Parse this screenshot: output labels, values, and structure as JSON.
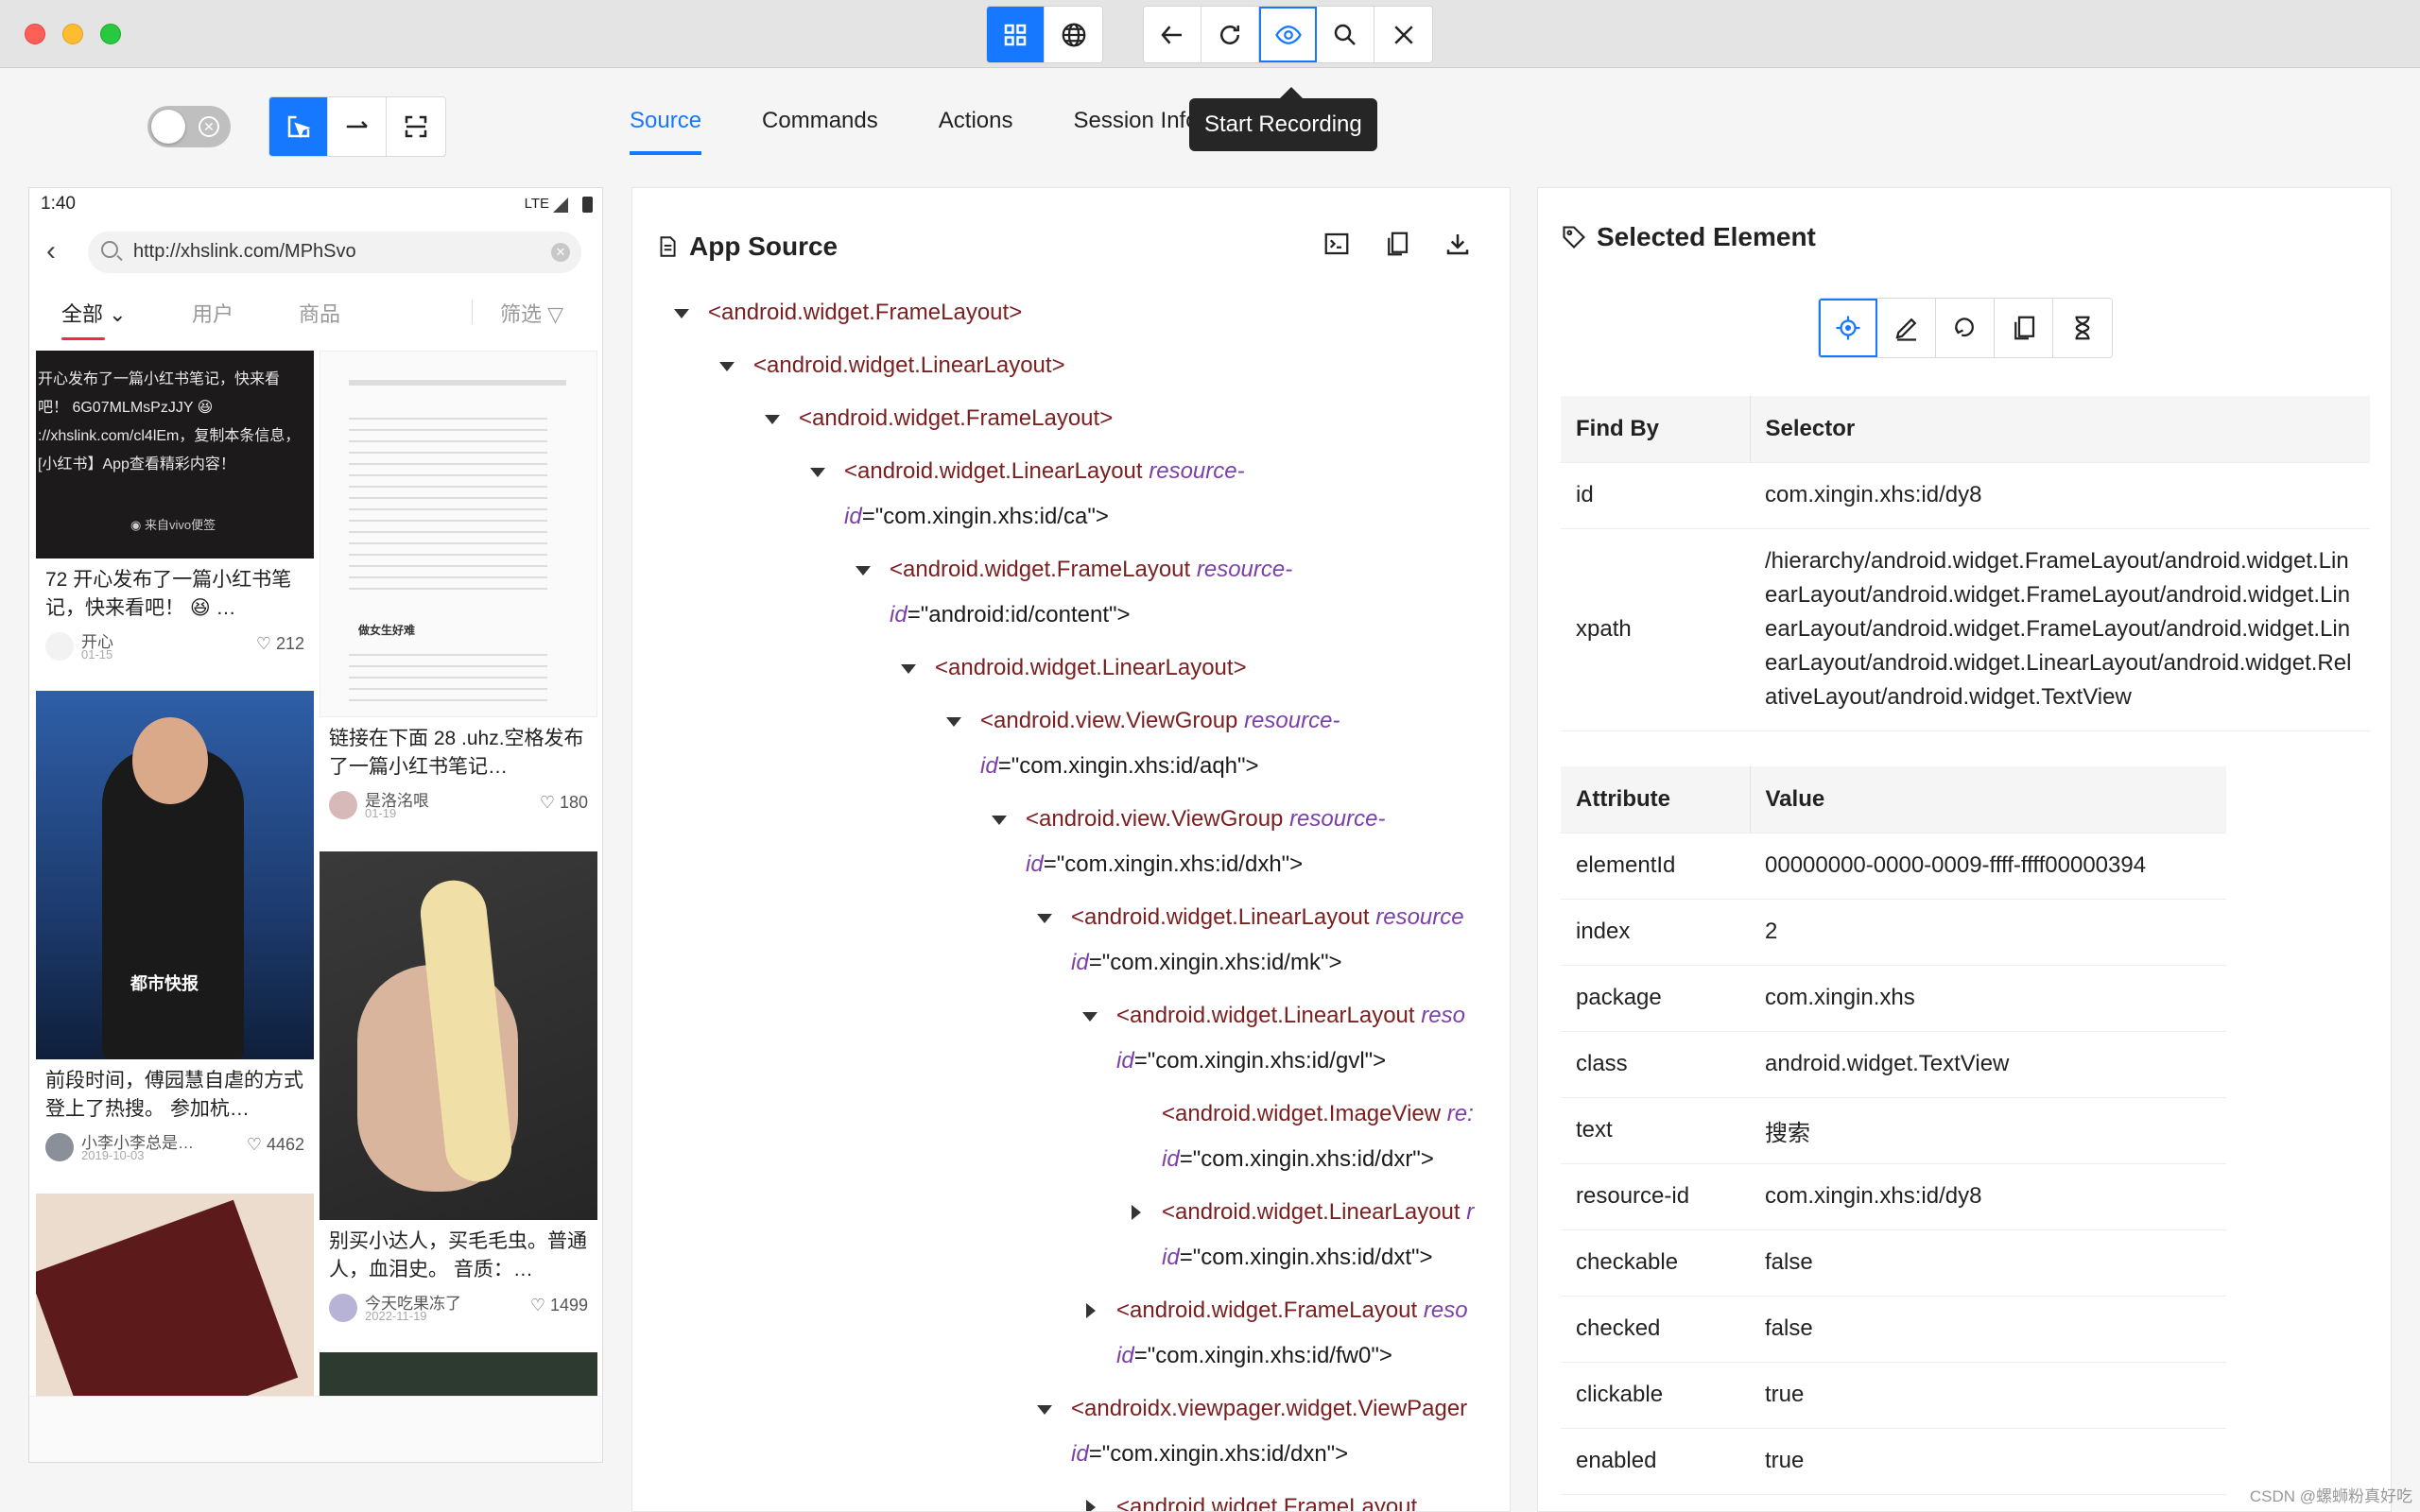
{
  "toolbar": {
    "buttons": [
      "grid-view",
      "web-globe",
      "back",
      "refresh",
      "start-recording",
      "search",
      "quit-session"
    ]
  },
  "tabs": [
    "Source",
    "Commands",
    "Actions",
    "Session Information"
  ],
  "tooltip": "Start Recording",
  "phone": {
    "time": "1:40",
    "network": "LTE",
    "search_text": "http://xhslink.com/MPhSvo",
    "filters": [
      "全部",
      "用户",
      "商品",
      "筛选"
    ],
    "cards": [
      {
        "title": "72 开心发布了一篇小红书笔记，快来看吧！ 😆 …",
        "author": "开心",
        "date": "01-15",
        "likes": "212",
        "image_text": "开心发布了一篇小红书笔记，快来看吧！ 6G07MLMsPzJJY 😆 ://xhslink.com/cl4lEm，复制本条信息，[小红书】App查看精彩内容！",
        "image_badge": "来自vivo便签"
      },
      {
        "title": "链接在下面 28 .uhz.空格发布了一篇小红书笔记…",
        "author": "是洛洺哏",
        "date": "01-19",
        "likes": "180",
        "image_text": "做女生好难"
      },
      {
        "title": "前段时间，傅园慧自虐的方式登上了热搜。 参加杭…",
        "author": "小李小李总是…",
        "date": "2019-10-03",
        "likes": "4462",
        "image_badge": "都市快报"
      },
      {
        "title": "别买小达人，买毛毛虫。普通人，血泪史。 音质：…",
        "author": "今天吃果冻了",
        "date": "2022-11-19",
        "likes": "1499"
      }
    ]
  },
  "source": {
    "title": "App Source",
    "nodes": [
      {
        "tag": "<android.widget.FrameLayout>"
      },
      {
        "tag": "<android.widget.LinearLayout>"
      },
      {
        "tag": "<android.widget.FrameLayout>"
      },
      {
        "tag": "<android.widget.LinearLayout",
        "attr": "resource-",
        "line2attr": "id",
        "line2val": "=\"com.xingin.xhs:id/ca\">"
      },
      {
        "tag": "<android.widget.FrameLayout",
        "attr": "resource-",
        "line2attr": "id",
        "line2val": "=\"android:id/content\">"
      },
      {
        "tag": "<android.widget.LinearLayout>"
      },
      {
        "tag": "<android.view.ViewGroup",
        "attr": "resource-",
        "line2attr": "id",
        "line2val": "=\"com.xingin.xhs:id/aqh\">"
      },
      {
        "tag": "<android.view.ViewGroup",
        "attr": "resource-",
        "line2attr": "id",
        "line2val": "=\"com.xingin.xhs:id/dxh\">"
      },
      {
        "tag": "<android.widget.LinearLayout",
        "attr": "resource",
        "line2attr": "id",
        "line2val": "=\"com.xingin.xhs:id/mk\">"
      },
      {
        "tag": "<android.widget.LinearLayout",
        "attr": "reso",
        "line2attr": "id",
        "line2val": "=\"com.xingin.xhs:id/gvl\">"
      },
      {
        "tag": "<android.widget.ImageView",
        "attr": "re:",
        "line2attr": "id",
        "line2val": "=\"com.xingin.xhs:id/dxr\">"
      },
      {
        "tag": "<android.widget.LinearLayout",
        "attr": "r",
        "line2attr": "id",
        "line2val": "=\"com.xingin.xhs:id/dxt\">"
      },
      {
        "tag": "<android.widget.FrameLayout",
        "attr": "reso",
        "line2attr": "id",
        "line2val": "=\"com.xingin.xhs:id/fw0\">"
      },
      {
        "tag": "<androidx.viewpager.widget.ViewPager",
        "attr": "",
        "line2attr": "id",
        "line2val": "=\"com.xingin.xhs:id/dxn\">"
      },
      {
        "tag": "<android.widget.FrameLayout"
      }
    ]
  },
  "selected": {
    "title": "Selected Element",
    "findby_headers": [
      "Find By",
      "Selector"
    ],
    "findby": [
      {
        "key": "id",
        "value": "com.xingin.xhs:id/dy8"
      },
      {
        "key": "xpath",
        "value": "/hierarchy/android.widget.FrameLayout/android.widget.LinearLayout/android.widget.FrameLayout/android.widget.LinearLayout/android.widget.FrameLayout/android.widget.LinearLayout/android.widget.LinearLayout/android.widget.RelativeLayout/android.widget.TextView"
      }
    ],
    "attr_headers": [
      "Attribute",
      "Value"
    ],
    "attributes": [
      {
        "key": "elementId",
        "value": "00000000-0000-0009-ffff-ffff00000394"
      },
      {
        "key": "index",
        "value": "2"
      },
      {
        "key": "package",
        "value": "com.xingin.xhs"
      },
      {
        "key": "class",
        "value": "android.widget.TextView"
      },
      {
        "key": "text",
        "value": "搜索"
      },
      {
        "key": "resource-id",
        "value": "com.xingin.xhs:id/dy8"
      },
      {
        "key": "checkable",
        "value": "false"
      },
      {
        "key": "checked",
        "value": "false"
      },
      {
        "key": "clickable",
        "value": "true"
      },
      {
        "key": "enabled",
        "value": "true"
      }
    ]
  },
  "watermark": "CSDN @螺蛳粉真好吃",
  "colors": {
    "accent": "#1677ff",
    "tag": "#7a1f1f",
    "attr": "#7b3fa8"
  }
}
